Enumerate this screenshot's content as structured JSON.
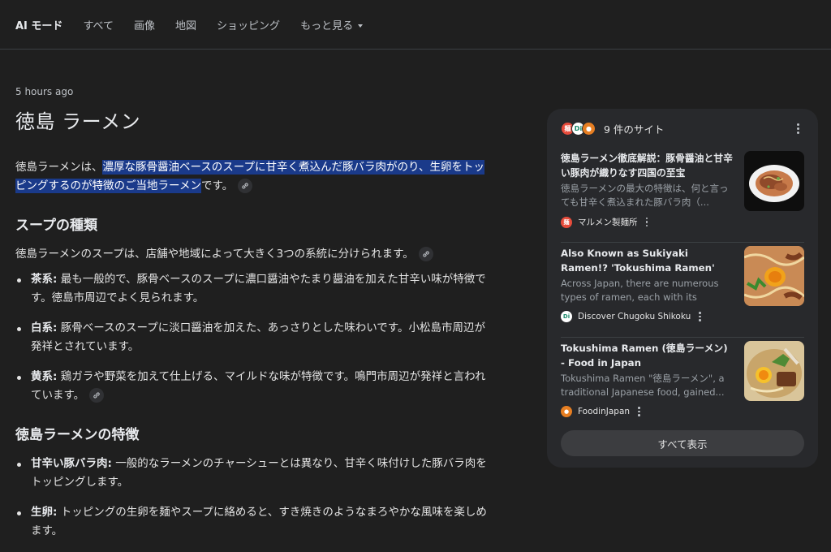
{
  "nav": {
    "tabs": [
      {
        "label": "AI モード"
      },
      {
        "label": "すべて"
      },
      {
        "label": "画像"
      },
      {
        "label": "地図"
      },
      {
        "label": "ショッピング"
      },
      {
        "label": "もっと見る"
      }
    ]
  },
  "main": {
    "timestamp": "5 hours ago",
    "query": "徳島 ラーメン",
    "intro_before": "徳島ラーメンは、",
    "intro_highlight": "濃厚な豚骨醤油ベースのスープに甘辛く煮込んだ豚バラ肉がのり、生卵をトッピングするのが特徴のご当地ラーメン",
    "intro_after": "です。",
    "section1_title": "スープの種類",
    "section1_intro": "徳島ラーメンのスープは、店舗や地域によって大きく3つの系統に分けられます。",
    "soups": [
      {
        "term": "茶系:",
        "text": " 最も一般的で、豚骨ベースのスープに濃口醤油やたまり醤油を加えた甘辛い味が特徴です。徳島市周辺でよく見られます。"
      },
      {
        "term": "白系:",
        "text": " 豚骨ベースのスープに淡口醤油を加えた、あっさりとした味わいです。小松島市周辺が発祥とされています。"
      },
      {
        "term": "黄系:",
        "text": " 鶏ガラや野菜を加えて仕上げる、マイルドな味が特徴です。鳴門市周辺が発祥と言われています。"
      }
    ],
    "section2_title": "徳島ラーメンの特徴",
    "features": [
      {
        "term": "甘辛い豚バラ肉:",
        "text": " 一般的なラーメンのチャーシューとは異なり、甘辛く味付けした豚バラ肉をトッピングします。"
      },
      {
        "term": "生卵:",
        "text": " トッピングの生卵を麺やスープに絡めると、すき焼きのようなまろやかな風味を楽しめます。"
      }
    ]
  },
  "sources": {
    "count_label": "9 件のサイト",
    "items": [
      {
        "title": "徳島ラーメン徹底解説：豚骨醤油と甘辛い豚肉が織りなす四国の至宝",
        "snippet": "徳島ラーメンの最大の特徴は、何と言っても甘辛く煮込まれた豚バラ肉（...",
        "site": "マルメン製麺所",
        "fav_color": "#e74c3c"
      },
      {
        "title": "Also Known as Sukiyaki Ramen!? 'Tokushima Ramen' Topped with a ...",
        "snippet": "Across Japan, there are numerous types of ramen, each with its unique...",
        "site": "Discover Chugoku Shikoku",
        "fav_color": "#ffffff"
      },
      {
        "title": "Tokushima Ramen (徳島ラーメン) - Food in Japan",
        "snippet": "Tokushima Ramen \"徳島ラーメン\", a traditional Japanese food, gained...",
        "site": "FoodinJapan",
        "fav_color": "#e67e22"
      }
    ],
    "show_all": "すべて表示"
  }
}
